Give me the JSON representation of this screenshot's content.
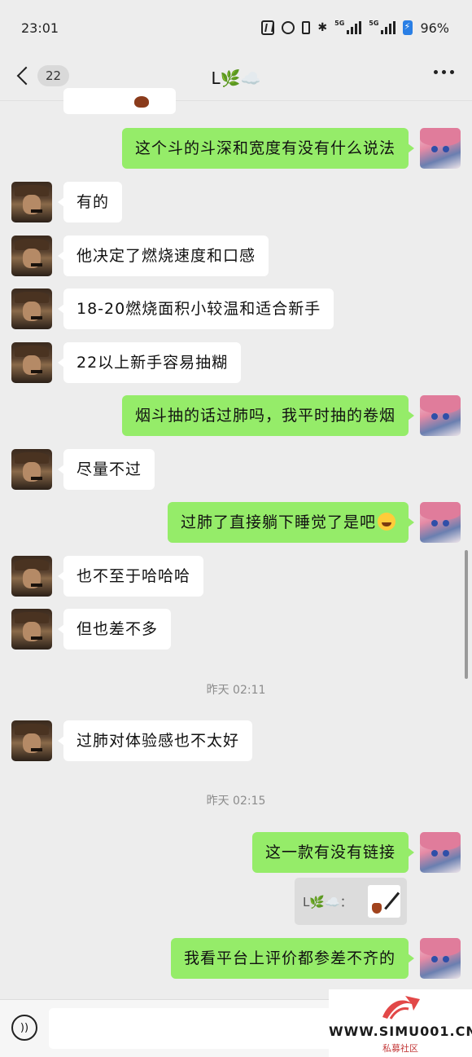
{
  "status_bar": {
    "time": "23:01",
    "battery": "96%",
    "network": "5G"
  },
  "nav": {
    "unread_count": "22",
    "title": "L🌿☁️"
  },
  "messages": [
    {
      "side": "right",
      "text": "这个斗的斗深和宽度有没有什么说法"
    },
    {
      "side": "left",
      "text": "有的"
    },
    {
      "side": "left",
      "text": "他决定了燃烧速度和口感"
    },
    {
      "side": "left",
      "text": "18-20燃烧面积小较温和适合新手"
    },
    {
      "side": "left",
      "text": "22以上新手容易抽糊"
    },
    {
      "side": "right",
      "text": "烟斗抽的话过肺吗，我平时抽的卷烟"
    },
    {
      "side": "left",
      "text": "尽量不过"
    },
    {
      "side": "right",
      "text": "过肺了直接躺下睡觉了是吧"
    },
    {
      "side": "left",
      "text": "也不至于哈哈哈"
    },
    {
      "side": "left",
      "text": "但也差不多"
    },
    {
      "side": "left",
      "text": "过肺对体验感也不太好"
    },
    {
      "side": "right",
      "text": "这一款有没有链接"
    },
    {
      "side": "right",
      "text": "我看平台上评价都参差不齐的"
    }
  ],
  "timestamps": [
    "昨天 02:11",
    "昨天 02:15"
  ],
  "quote": {
    "text": "L🌿☁️："
  },
  "watermark": {
    "url": "WWW.SIMU001.CN",
    "sub": "私募社区"
  }
}
